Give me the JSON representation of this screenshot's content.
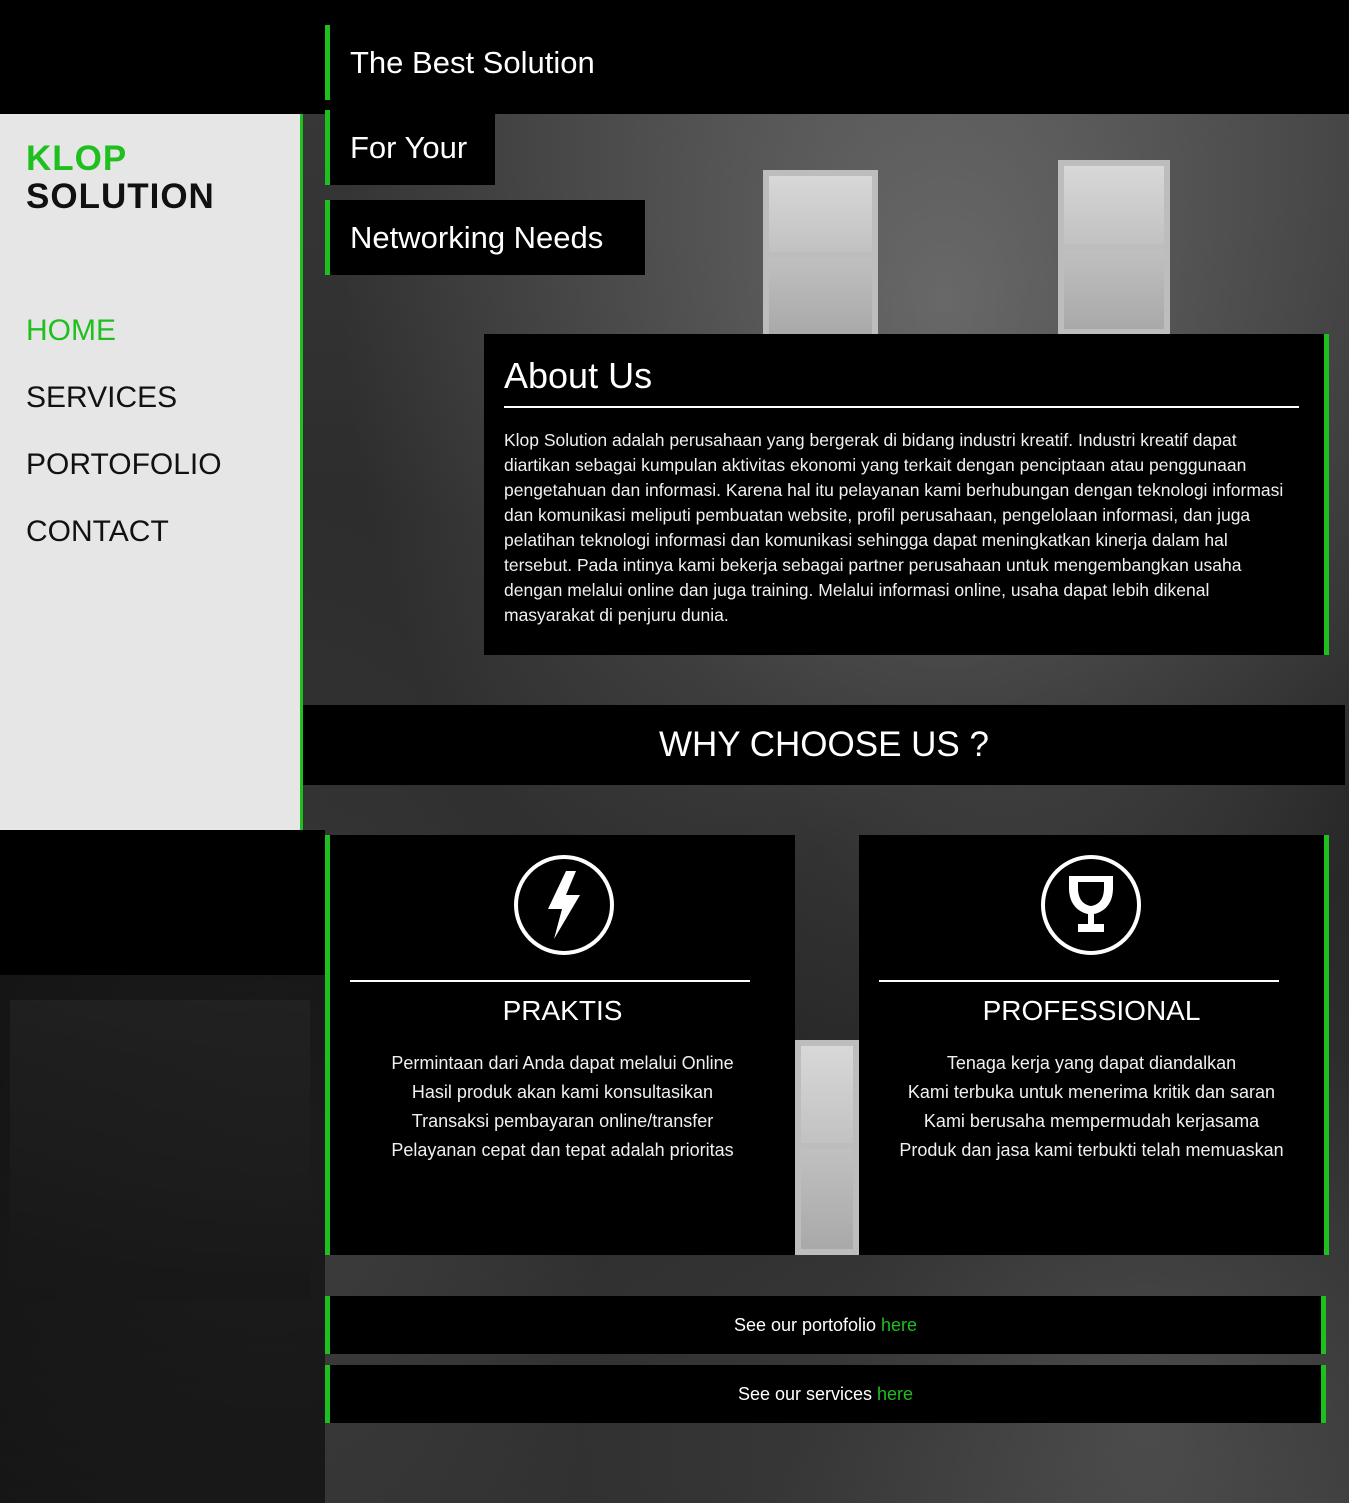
{
  "brand": {
    "line1": "KLOP",
    "line2": "SOLUTION"
  },
  "nav": {
    "items": [
      {
        "label": "HOME",
        "active": true
      },
      {
        "label": "SERVICES",
        "active": false
      },
      {
        "label": "PORTOFOLIO",
        "active": false
      },
      {
        "label": "CONTACT",
        "active": false
      }
    ]
  },
  "hero": {
    "lines": [
      "The Best Solution",
      "For Your",
      "Networking Needs"
    ]
  },
  "about": {
    "title": "About Us",
    "body": "Klop Solution adalah perusahaan yang bergerak di bidang industri kreatif. Industri kreatif dapat diartikan sebagai kumpulan aktivitas ekonomi yang terkait dengan penciptaan atau penggunaan pengetahuan dan informasi. Karena hal itu pelayanan kami berhubungan dengan teknologi informasi dan komunikasi meliputi pembuatan website, profil perusahaan, pengelolaan informasi, dan juga pelatihan teknologi informasi dan komunikasi sehingga dapat meningkatkan kinerja dalam hal tersebut. Pada intinya kami bekerja sebagai partner perusahaan untuk mengembangkan usaha dengan melalui online dan juga training. Melalui informasi online, usaha dapat lebih dikenal masyarakat di penjuru dunia."
  },
  "why": {
    "title": "WHY CHOOSE US ?"
  },
  "features": [
    {
      "icon": "lightning-icon",
      "title": "PRAKTIS",
      "points": [
        "Permintaan dari Anda dapat melalui Online",
        "Hasil produk akan kami konsultasikan",
        "Transaksi pembayaran online/transfer",
        "Pelayanan cepat dan tepat adalah prioritas"
      ]
    },
    {
      "icon": "trophy-icon",
      "title": "PROFESSIONAL",
      "points": [
        "Tenaga kerja yang dapat diandalkan",
        "Kami terbuka untuk menerima kritik dan saran",
        "Kami berusaha mempermudah kerjasama",
        "Produk dan jasa kami terbukti telah memuaskan"
      ]
    }
  ],
  "links": {
    "portfolio": {
      "text": "See our portofolio ",
      "link": "here"
    },
    "services": {
      "text": "See our services ",
      "link": "here"
    }
  },
  "colors": {
    "accent": "#1fbf1f",
    "panel": "#000000",
    "sidebar": "#e6e6e6"
  }
}
